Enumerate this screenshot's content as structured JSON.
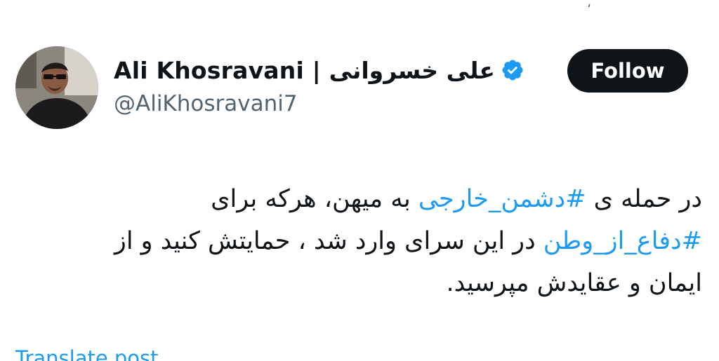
{
  "top_fragment": "،",
  "author": {
    "display_name": "Ali Khosravani | علی خسروانی",
    "handle": "@AliKhosravani7",
    "verified": true,
    "verified_icon": "verified-badge-icon"
  },
  "follow_button": {
    "label": "Follow"
  },
  "tweet": {
    "lines": [
      [
        {
          "text": "در حمله ی ",
          "type": "text"
        },
        {
          "text": "#دشمن_خارجی",
          "type": "hashtag"
        },
        {
          "text": " به میهن، هرکه برای",
          "type": "text"
        }
      ],
      [
        {
          "text": "#دفاع_از_وطن",
          "type": "hashtag"
        },
        {
          "text": " در این سرای وارد شد ، حمایتش کنید و از",
          "type": "text"
        }
      ],
      [
        {
          "text": "ایمان و عقایدش مپرسید.",
          "type": "text"
        }
      ]
    ]
  },
  "translate": {
    "label": "Translate post"
  },
  "colors": {
    "link": "#1d9bf0",
    "text": "#0f1419",
    "secondary": "#536471",
    "button_bg": "#0f1419",
    "verified": "#1d9bf0"
  }
}
